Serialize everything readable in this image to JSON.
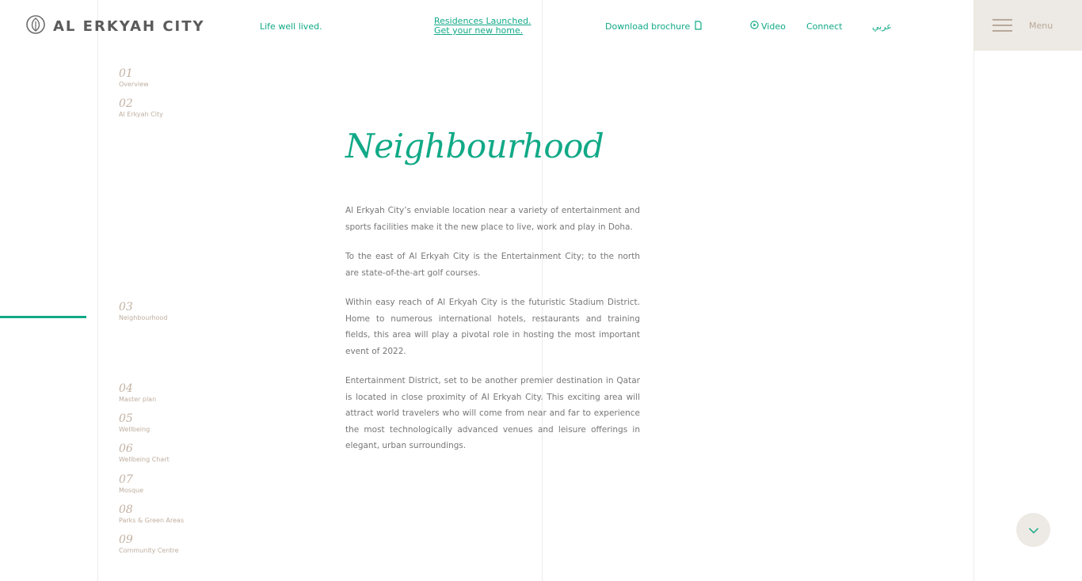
{
  "header": {
    "logo_text": "AL ERKYAH CITY",
    "tagline": "Life well lived.",
    "residences_line1": "Residences Launched.",
    "residences_line2": "Get your new home.",
    "download_label": "Download brochure",
    "video_label": "Video",
    "connect_label": "Connect",
    "arabic_label": "عربي",
    "menu_label": "Menu"
  },
  "sidebar": {
    "items": [
      {
        "num": "01",
        "label": "Overview"
      },
      {
        "num": "02",
        "label": "Al Erkyah City"
      },
      {
        "num": "03",
        "label": "Neighbourhood"
      },
      {
        "num": "04",
        "label": "Master plan"
      },
      {
        "num": "05",
        "label": "Wellbeing"
      },
      {
        "num": "06",
        "label": "Wellbeing Chart"
      },
      {
        "num": "07",
        "label": "Mosque"
      },
      {
        "num": "08",
        "label": "Parks & Green Areas"
      },
      {
        "num": "09",
        "label": "Community Centre"
      }
    ]
  },
  "main": {
    "title": "Neighbourhood",
    "paragraphs": [
      "Al Erkyah City’s enviable location near a variety of entertainment and sports facilities make it the new place to live, work and play in Doha.",
      "To the east of Al Erkyah City is the Entertainment City; to the north are state-of-the-art golf courses.",
      "Within easy reach of Al Erkyah City is the futuristic Stadium District. Home to numerous international hotels, restaurants and training fields, this area will play a pivotal role in hosting the most important event of 2022.",
      "Entertainment District, set to be another premier destination in Qatar is located in close proximity of Al Erkyah City. This exciting area will attract world travelers who will come from near and far to experience the most technologically advanced venues and leisure offerings in elegant, urban surroundings."
    ]
  },
  "colors": {
    "accent": "#11a987",
    "muted": "#c3b2a3",
    "menu_bg": "#ede9e4"
  },
  "icons": {
    "logo": "leaf-logo-icon",
    "download": "document-icon",
    "video": "play-circle-icon",
    "menu": "hamburger-icon",
    "scroll": "chevron-down-icon"
  }
}
